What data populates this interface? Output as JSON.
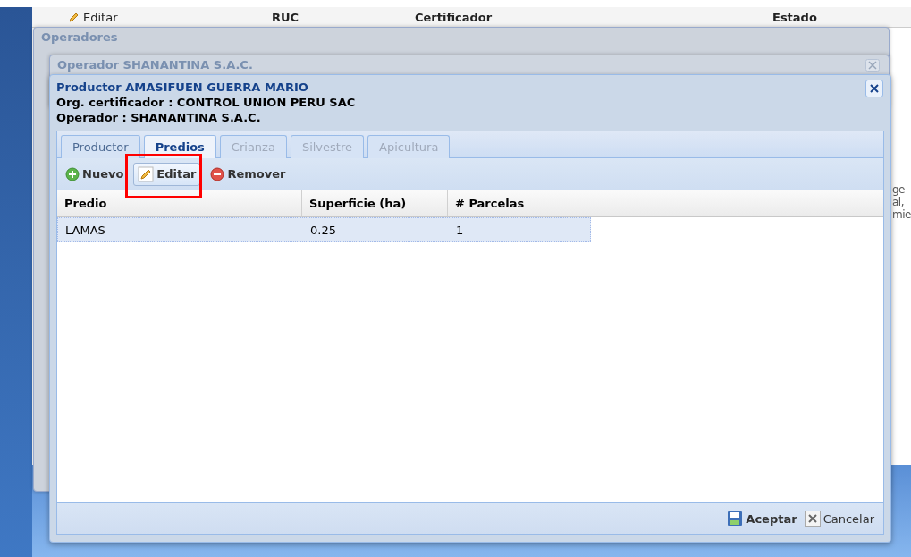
{
  "background_grid": {
    "edit_button": "Editar",
    "columns": [
      "RUC",
      "Certificador",
      "Estado"
    ]
  },
  "right_fragments": [
    "ge",
    "al,",
    "mie"
  ],
  "operadores_window": {
    "title": "Operadores"
  },
  "operador_window": {
    "title": "Operador SHANANTINA S.A.C."
  },
  "productor_dialog": {
    "title": "Productor AMASIFUEN GUERRA MARIO",
    "lines": [
      "Org. certificador : CONTROL UNION PERU SAC",
      "Operador : SHANANTINA S.A.C."
    ],
    "tabs": [
      {
        "label": "Productor",
        "selected": false,
        "disabled": false
      },
      {
        "label": "Predios",
        "selected": true,
        "disabled": false
      },
      {
        "label": "Crianza",
        "selected": false,
        "disabled": true
      },
      {
        "label": "Silvestre",
        "selected": false,
        "disabled": true
      },
      {
        "label": "Apicultura",
        "selected": false,
        "disabled": true
      }
    ],
    "toolbar": [
      {
        "kind": "add",
        "label": "Nuevo",
        "highlighted": false
      },
      {
        "kind": "edit",
        "label": "Editar",
        "highlighted": true
      },
      {
        "kind": "remove",
        "label": "Remover",
        "highlighted": false
      }
    ],
    "table": {
      "columns": [
        "Predio",
        "Superficie (ha)",
        "# Parcelas"
      ],
      "rows": [
        {
          "cells": [
            "LAMAS",
            "0.25",
            "1"
          ],
          "selected": true
        }
      ]
    },
    "footer": [
      {
        "kind": "save",
        "label": "Aceptar"
      },
      {
        "kind": "cancel",
        "label": "Cancelar"
      }
    ]
  }
}
